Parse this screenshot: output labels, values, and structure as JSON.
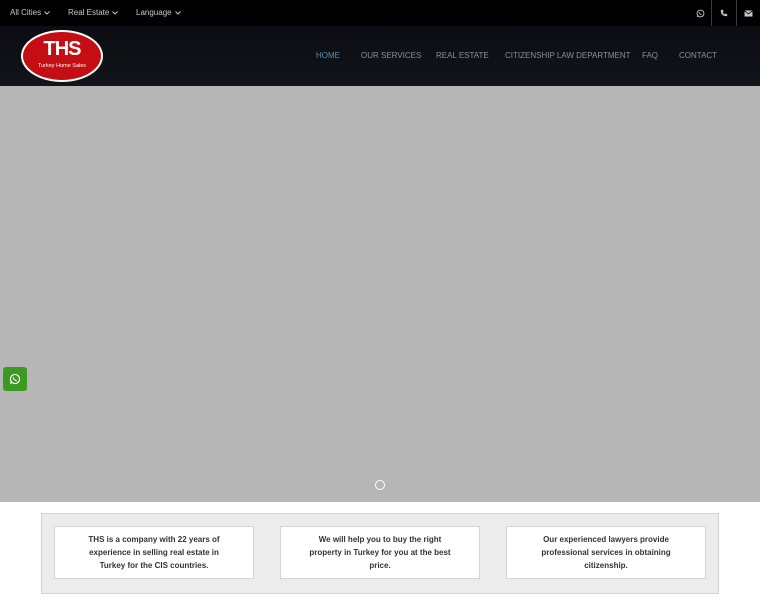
{
  "topbar": {
    "dropdowns": [
      "All Cities",
      "Real Estate",
      "Language"
    ],
    "icons": [
      "whatsapp-icon",
      "phone-icon",
      "mail-icon"
    ]
  },
  "logo": {
    "text": "THS",
    "subtitle": "Turkey Home Sales",
    "color": "#c40e13"
  },
  "nav": {
    "items": [
      "HOME",
      "OUR SERVICES",
      "REAL ESTATE",
      "CITIZENSHIP LAW DEPARTMENT",
      "FAQ",
      "CONTACT"
    ],
    "active": "HOME",
    "active_color": "#5a8fb3"
  },
  "hero": {
    "slides": 1,
    "current_slide": 1
  },
  "floating": {
    "icon": "whatsapp-icon",
    "color": "#3b9a1f"
  },
  "features": [
    "THS is a company with 22 years of experience in selling real estate in Turkey for the CIS countries.",
    "We will help you to buy the right property in Turkey for you at the best price.",
    "Our experienced lawyers provide professional services in obtaining citizenship."
  ]
}
